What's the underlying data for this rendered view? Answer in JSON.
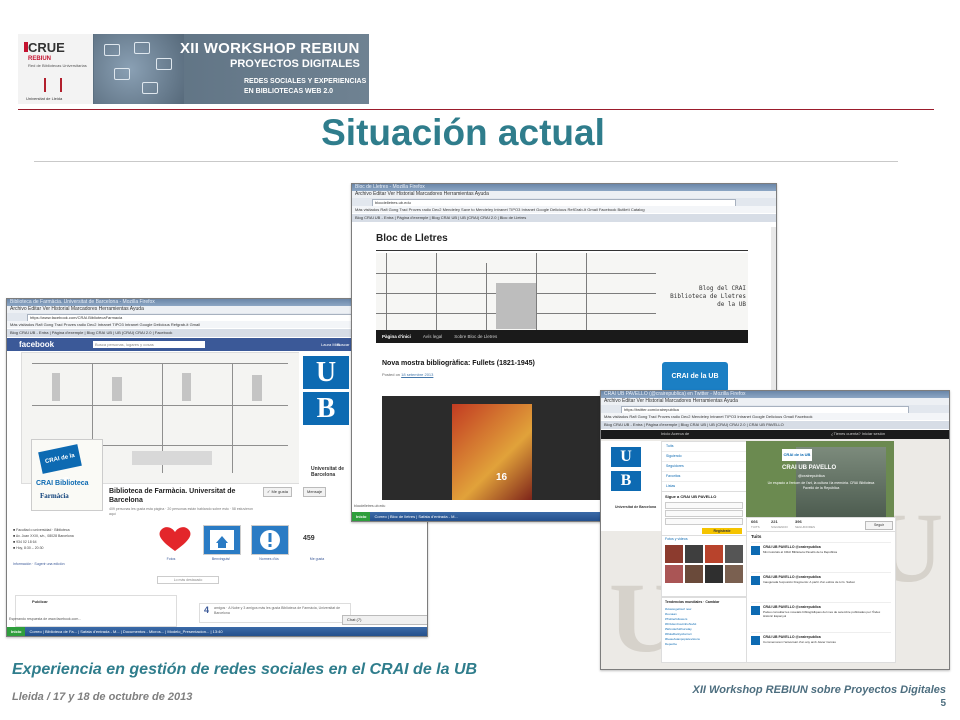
{
  "banner": {
    "crue": "CRUE",
    "rebiun": "REBIUN",
    "rebiun_sub": "Red de Bibliotecas Universitarias",
    "university": "Universitat de Lleida",
    "title_1": "XII WORKSHOP REBIUN",
    "title_2": "PROYECTOS DIGITALES",
    "title_3": "REDES SOCIALES Y EXPERIENCIAS",
    "title_4": "EN BIBLIOTECAS WEB 2.0"
  },
  "slide": {
    "title": "Situación actual"
  },
  "facebook_shot": {
    "window_title": "Biblioteca de Farmàcia. Universitat de Barcelona - Mozilla Firefox",
    "menu": "Archivo   Editar   Ver   Historial   Marcadores   Herramientas   Ayuda",
    "url": "https://www.facebook.com/CRAI.BibliotecaFarmacia",
    "bookmarks": "Más visitados   Rafi   Gong Trad   Proves radio   Dec2   Intranet   TIPO3 Intranet   Google   Delicious   Refgrab-it   Gmail",
    "tabs": "Blog CRAI UB - Entra | Página d'exemple | Blog CRAI UB | UB (CRAI) CRAI 2.0 | Facebook",
    "logo": "facebook",
    "search_placeholder": "Busca personas, lugares y cosas",
    "user": "Laura Miró",
    "search_btn": "Buscar",
    "ub_name": "Universitat de Barcelona",
    "profile_crai": "CRAI Biblioteca",
    "profile_farmacia": "Farmàcia",
    "crai_logo": "CRAI de la UB",
    "page_name": "Biblioteca de Farmàcia. Universitat de Barcelona",
    "page_desc": "409 personas les gusta esta página · 20 personas están hablando sobre esto · 58 estuvieron aquí",
    "like_btn": "✓ Me gusta",
    "message_btn": "Mensaje",
    "info_lines": "■ Facultad o universidad · Biblioteca\n■ Av. Joan XXIII, s/n., 08028 Barcelona\n■ 934 02 18 64\n■ Hoy, 8:30 – 20:30",
    "info_link": "Información · Sugerir una edición",
    "app_1": "Fotos",
    "app_2": "Benvinguts!",
    "app_3": "Normes d'ús",
    "app_4": "Me gusta",
    "likes_count": "459",
    "separator": "Lo más destacado",
    "publicar": "Publicar",
    "amigos_count": "4",
    "amigos_text": "amigos · A Nube y 3 amigos más les gusta Biblioteca de Farmàcia, Universitat de Barcelona",
    "chat": "Chat (7)",
    "status": "Esperando respuesta de www.facebook.com...",
    "taskbar": "Correo  |  Biblioteca de Fa...  |  Safata d'entrada - M...  |  Documentos - Micros...  |  Modelo_Presentacion...  |  13:40",
    "start": "Inicio"
  },
  "blog_shot": {
    "window_title": "Bloc de Lletres - Mozilla Firefox",
    "menu": "Archivo   Editar   Ver   Historial   Marcadores   Herramientas   Ayuda",
    "url": "blocdelletres.ub.edu",
    "bookmarks": "Más visitados   Rafi   Gong Trad   Proves radio   Dec2   Mendeley   Save to Mendeley   Intranet   TIPO3 Intranet   Google   Delicious   RefGrab-It   Gmail   Facebook   Butlletí   Catalog",
    "tabs": "Blog CRAI UB - Entra | Página d'exemple | Blog CRAI UB | UB (CRAI) CRAI 2.0 | Bloc de Lletres",
    "blog_title": "Bloc de Lletres",
    "hero_text": "Blog del CRAI Biblioteca de Lletres de la UB",
    "nav_1": "Pàgina d'inici",
    "nav_2": "Avís legal",
    "nav_3": "Sobre Bloc de Lletres",
    "post_title": "Nova mostra bibliogràfica: Fullets (1821-1945)",
    "posted_prefix": "Posted on",
    "posted_date": "18 setembre 2013",
    "crai_badge": "CRAI de la UB",
    "poster_number": "16",
    "status": "blocdelletres.ub.edu",
    "taskbar": "Correo  |  Bloc de lletres  |  Safata d'entrada - M...",
    "start": "Inicio"
  },
  "twitter_shot": {
    "window_title": "CRAI UB PAVELLO (@crairepublica) en Twitter - Mozilla Firefox",
    "menu": "Archivo   Editar   Ver   Historial   Marcadores   Herramientas   Ayuda",
    "url": "https://twitter.com/crairepublica",
    "bookmarks": "Más visitados   Rafi   Gong Trad   Proves radio   Dec2   Mendeley   Intranet   TIPO3 Intranet   Google   Delicious   Gmail   Facebook",
    "tabs": "Blog CRAI UB - Entra | Página d'exemple | Blog CRAI UB | UB (CRAI) CRAI 2.0 | CRAI UB PAVELLO",
    "topbar_left": "Inicio   Acerca de",
    "topbar_right": "¿Tienes cuenta? Iniciar sesión",
    "univ": "Universitat de Barcelona",
    "nav_tweets": "Tuits",
    "nav_following": "Siguiendo",
    "nav_followers": "Seguidores",
    "nav_favs": "Favoritos",
    "nav_lists": "Listas",
    "follow_title": "Sigue a CRAI UB PAVELLO",
    "register": "Regístrate",
    "header_logo": "CRAI de la UB",
    "name": "CRAI UB PAVELLO",
    "handle": "@crairepublica",
    "bio": "Un espacio a l'entorn de l'art, la cultura i la memòria. CRAI Biblioteca Pavelló de la República",
    "stat_1_n": "666",
    "stat_1_l": "TUITS",
    "stat_2_n": "221",
    "stat_2_l": "SIGUIENDO",
    "stat_3_n": "396",
    "stat_3_l": "SEGUIDORES",
    "follow_btn": "Seguir",
    "tweets_header": "Tuits",
    "tweet_name": "CRAI UB PAVELLO @crairepublica",
    "tweet_1": "Mini tutorials al CRAI Biblioteca Pavelló de la República",
    "tweet_2": "Inaugurada l'exposició Fragments: A partir d'un esbós de H.G. Salvat",
    "tweet_3": "Podeu consultar les novetats bibliogràfiques del mes de setembre publicades per l'Índex Històric Espanyol",
    "tweet_4": "Commemorem l'aniversari d'un any amb Javier Cercas",
    "photos_title": "Fotos y videos",
    "trends_title": "Tendencias mundiales · Cambiar",
    "trends_list": "#HowtogetGurl now\n#Lunaan\n#Twitterfollowers\n#DrivitenCoutinhoNoAtt\n#Wonderfulthursday\n#RolaRockysFerrari\n#beauAsianpoptelevisions\nDepecbe"
  },
  "footer": {
    "title": "Experiencia  en gestión de redes sociales en el CRAI de la UB",
    "date": "Lleida / 17 y 18 de octubre de 2013",
    "workshop": "XII Workshop REBIUN sobre Proyectos Digitales",
    "page": "5"
  },
  "colors": {
    "title": "#2f7d8c",
    "rule": "#9b1c2c",
    "facebook_blue": "#3b5998",
    "ub_blue": "#0d6ab2"
  }
}
